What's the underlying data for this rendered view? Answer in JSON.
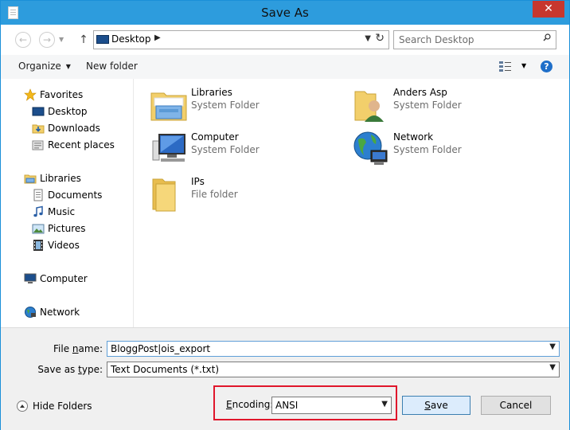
{
  "window": {
    "title": "Save As",
    "close_glyph": "✕"
  },
  "nav": {
    "back_icon": "back-arrow-icon",
    "forward_icon": "forward-arrow-icon",
    "up_icon": "up-arrow-icon",
    "address": {
      "location": "Desktop",
      "icon": "desktop-icon"
    },
    "search": {
      "placeholder": "Search Desktop",
      "icon": "search-icon"
    }
  },
  "toolbar": {
    "organize_label": "Organize",
    "new_folder_label": "New folder",
    "view_icon": "view-options-icon",
    "help_icon": "help-icon"
  },
  "sidebar": {
    "favorites": {
      "label": "Favorites",
      "items": [
        {
          "label": "Desktop",
          "icon": "desktop-icon"
        },
        {
          "label": "Downloads",
          "icon": "downloads-folder-icon"
        },
        {
          "label": "Recent places",
          "icon": "recent-places-icon"
        }
      ]
    },
    "libraries": {
      "label": "Libraries",
      "items": [
        {
          "label": "Documents",
          "icon": "documents-icon"
        },
        {
          "label": "Music",
          "icon": "music-icon"
        },
        {
          "label": "Pictures",
          "icon": "pictures-icon"
        },
        {
          "label": "Videos",
          "icon": "videos-icon"
        }
      ]
    },
    "computer": {
      "label": "Computer",
      "icon": "computer-icon"
    },
    "network": {
      "label": "Network",
      "icon": "network-icon"
    }
  },
  "files": [
    {
      "name": "Libraries",
      "type": "System Folder",
      "icon": "libraries-folder-icon"
    },
    {
      "name": "Anders Asp",
      "type": "System Folder",
      "icon": "user-folder-icon"
    },
    {
      "name": "Computer",
      "type": "System Folder",
      "icon": "computer-icon"
    },
    {
      "name": "Network",
      "type": "System Folder",
      "icon": "network-icon"
    },
    {
      "name": "IPs",
      "type": "File folder",
      "icon": "folder-icon"
    }
  ],
  "form": {
    "file_name_label_pre": "File ",
    "file_name_label_acc": "n",
    "file_name_label_post": "ame:",
    "file_name_value": "BloggPost|ois_export",
    "save_type_label_pre": "Save as ",
    "save_type_label_acc": "t",
    "save_type_label_post": "ype:",
    "save_type_value": "Text Documents (*.txt)",
    "encoding_label_acc": "E",
    "encoding_label_post": "ncoding:",
    "encoding_value": "ANSI"
  },
  "footer": {
    "hide_folders_label": "Hide Folders",
    "save_acc": "S",
    "save_post": "ave",
    "cancel_label": "Cancel"
  },
  "colors": {
    "titlebar": "#2d9cdd",
    "close_button": "#c7372e",
    "highlight_border": "#e0162b"
  }
}
